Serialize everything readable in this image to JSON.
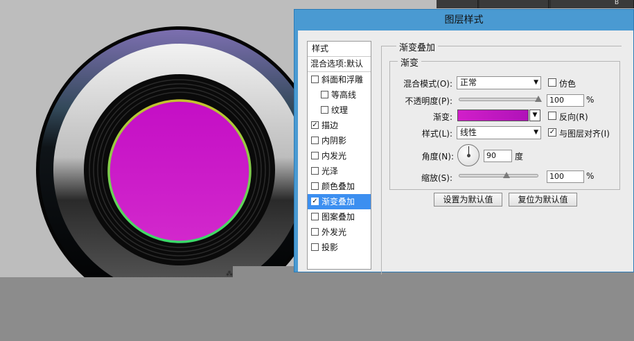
{
  "top_strip": {
    "label": "B"
  },
  "dialog": {
    "title": "图层样式",
    "styles_panel": {
      "header": "样式",
      "blend_options": "混合选项:默认",
      "items": [
        {
          "label": "斜面和浮雕",
          "checked": false,
          "indent": false,
          "selected": false
        },
        {
          "label": "等高线",
          "checked": false,
          "indent": true,
          "selected": false
        },
        {
          "label": "纹理",
          "checked": false,
          "indent": true,
          "selected": false
        },
        {
          "label": "描边",
          "checked": true,
          "indent": false,
          "selected": false
        },
        {
          "label": "内阴影",
          "checked": false,
          "indent": false,
          "selected": false
        },
        {
          "label": "内发光",
          "checked": false,
          "indent": false,
          "selected": false
        },
        {
          "label": "光泽",
          "checked": false,
          "indent": false,
          "selected": false
        },
        {
          "label": "颜色叠加",
          "checked": false,
          "indent": false,
          "selected": false
        },
        {
          "label": "渐变叠加",
          "checked": true,
          "indent": false,
          "selected": true
        },
        {
          "label": "图案叠加",
          "checked": false,
          "indent": false,
          "selected": false
        },
        {
          "label": "外发光",
          "checked": false,
          "indent": false,
          "selected": false
        },
        {
          "label": "投影",
          "checked": false,
          "indent": false,
          "selected": false
        }
      ]
    },
    "settings": {
      "section_title": "渐变叠加",
      "group_title": "渐变",
      "blend_mode": {
        "label": "混合模式(O):",
        "value": "正常"
      },
      "dither": {
        "label": "仿色",
        "checked": false
      },
      "opacity": {
        "label": "不透明度(P):",
        "value": "100",
        "unit": "%",
        "level": 1.0
      },
      "gradient": {
        "label": "渐变:",
        "start_color": "#d11fc9",
        "end_color": "#b012b8"
      },
      "reverse": {
        "label": "反向(R)",
        "checked": false
      },
      "style": {
        "label": "样式(L):",
        "value": "线性"
      },
      "align_with_layer": {
        "label": "与图层对齐(I)",
        "checked": true
      },
      "angle": {
        "label": "角度(N):",
        "value": "90",
        "unit": "度"
      },
      "scale": {
        "label": "缩放(S):",
        "value": "100",
        "unit": "%",
        "level": 0.6
      },
      "buttons": {
        "make_default": "设置为默认值",
        "reset_default": "复位为默认值"
      }
    }
  },
  "colors": {
    "dialog_title_bar": "#4a9ad2",
    "selected_item": "#3c8ff0",
    "artwork_fill": "#c812c8"
  }
}
